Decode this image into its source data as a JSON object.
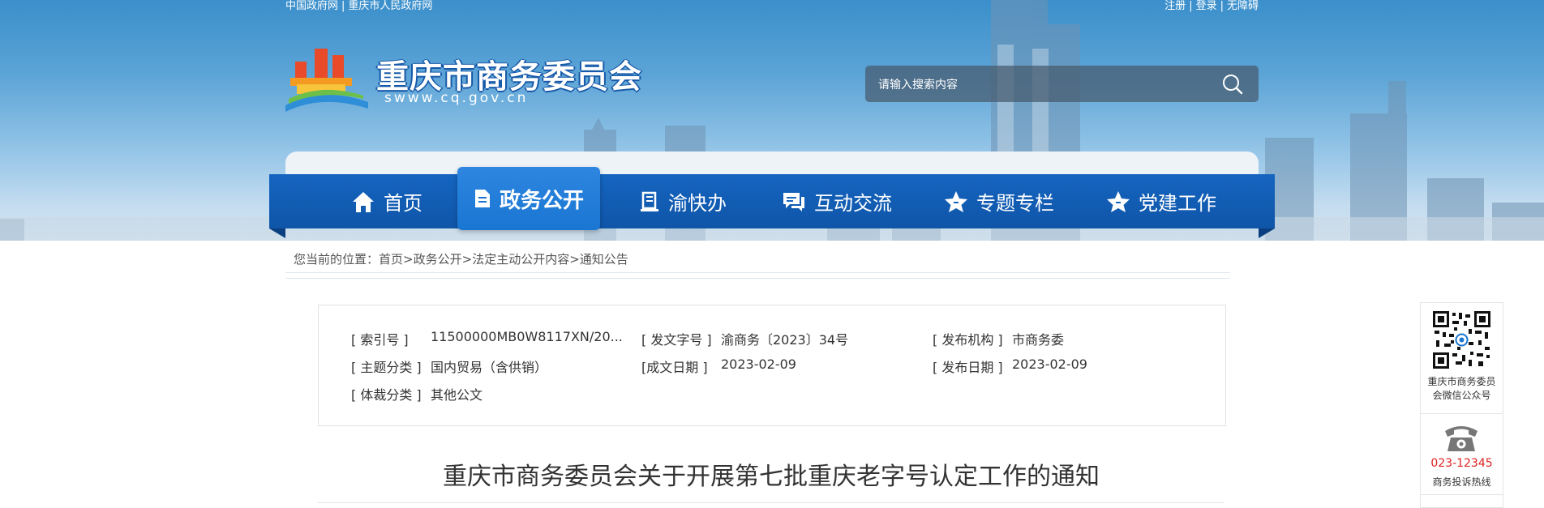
{
  "top_links": {
    "left": [
      "中国政府网",
      "重庆市人民政府网"
    ],
    "right": [
      "注册",
      "登录",
      "无障碍"
    ],
    "separator": "|"
  },
  "site": {
    "name": "重庆市商务委员会",
    "domain": "swww.cq.gov.cn"
  },
  "search": {
    "placeholder": "请输入搜索内容"
  },
  "nav": {
    "items": [
      {
        "label": "首页",
        "icon": "home-icon"
      },
      {
        "label": "政务公开",
        "icon": "document-icon",
        "active": true
      },
      {
        "label": "渝快办",
        "icon": "book-icon"
      },
      {
        "label": "互动交流",
        "icon": "chat-icon"
      },
      {
        "label": "专题专栏",
        "icon": "star-icon"
      },
      {
        "label": "党建工作",
        "icon": "star-icon"
      }
    ]
  },
  "breadcrumb": {
    "prefix": "您当前的位置：",
    "items": [
      "首页",
      "政务公开",
      "法定主动公开内容",
      "通知公告"
    ],
    "separator": ">"
  },
  "meta": {
    "rows": [
      [
        {
          "label": "[ 索引号 ]",
          "value": "11500000MB0W8117XN/20..."
        },
        {
          "label": "[ 发文字号 ]",
          "value": "渝商务〔2023〕34号"
        },
        {
          "label": "[ 发布机构 ]",
          "value": "市商务委"
        }
      ],
      [
        {
          "label": "[ 主题分类 ]",
          "value": "国内贸易（含供销）"
        },
        {
          "label": "[成文日期 ]",
          "value": "2023-02-09"
        },
        {
          "label": "[ 发布日期 ]",
          "value": "2023-02-09"
        }
      ],
      [
        {
          "label": "[ 体裁分类 ]",
          "value": "其他公文"
        }
      ]
    ]
  },
  "document": {
    "title": "重庆市商务委员会关于开展第七批重庆老字号认定工作的通知"
  },
  "float_panel": {
    "qr_caption_line1": "重庆市商务委员",
    "qr_caption_line2": "会微信公众号",
    "hotline": "023-12345",
    "hotline_caption": "商务投诉热线"
  },
  "colors": {
    "nav_blue": "#1565c0",
    "nav_active": "#1976d2",
    "hotline_red": "#e02020"
  }
}
